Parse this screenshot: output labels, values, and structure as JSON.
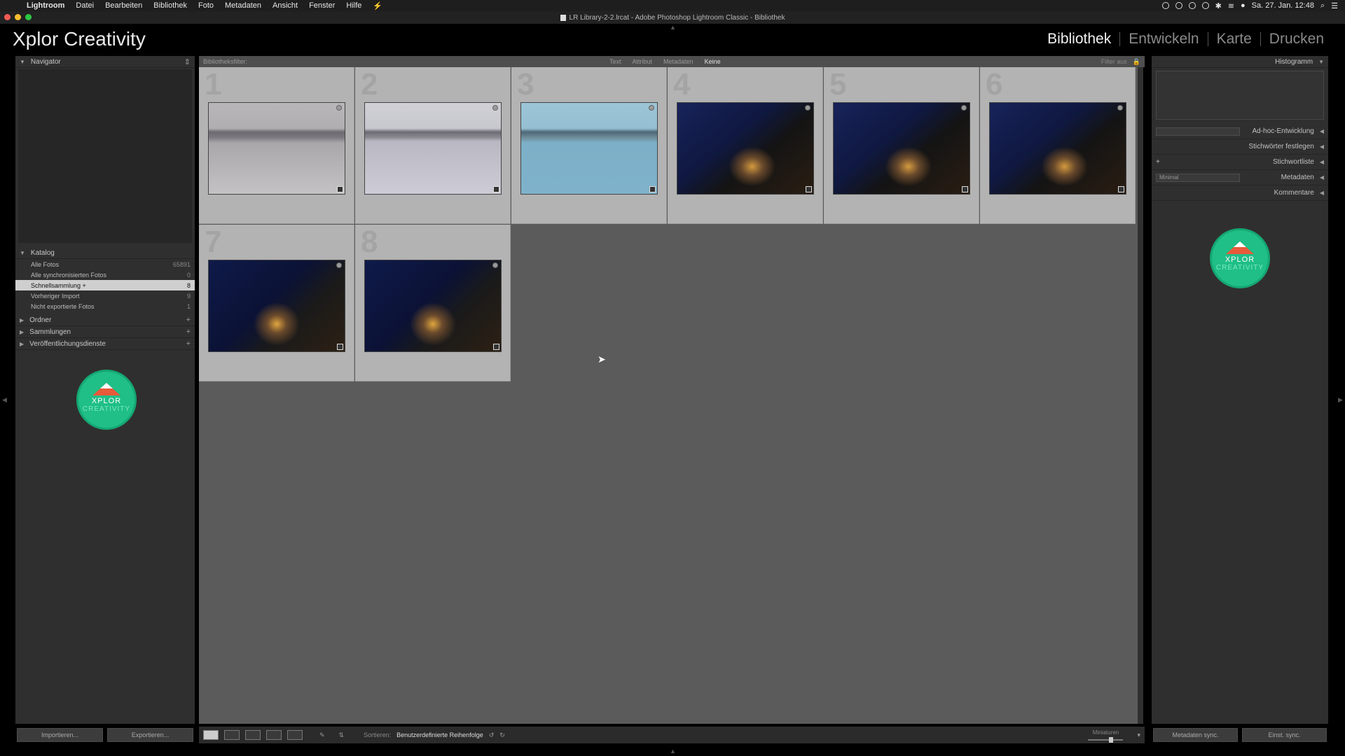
{
  "menubar": {
    "app_name": "Lightroom",
    "items": [
      "Datei",
      "Bearbeiten",
      "Bibliothek",
      "Foto",
      "Metadaten",
      "Ansicht",
      "Fenster",
      "Hilfe"
    ],
    "clock": "Sa. 27. Jan. 12:48"
  },
  "window": {
    "title": "LR Library-2-2.lrcat - Adobe Photoshop Lightroom Classic - Bibliothek"
  },
  "identity_plate": "Xplor Creativity",
  "modules": [
    {
      "label": "Bibliothek",
      "active": true
    },
    {
      "label": "Entwickeln",
      "active": false
    },
    {
      "label": "Karte",
      "active": false
    },
    {
      "label": "Drucken",
      "active": false
    }
  ],
  "left_panel": {
    "navigator_title": "Navigator",
    "catalog_title": "Katalog",
    "catalog_items": [
      {
        "label": "Alle Fotos",
        "count": "65891"
      },
      {
        "label": "Alle synchronisierten Fotos",
        "count": "0"
      },
      {
        "label": "Schnellsammlung +",
        "count": "8"
      },
      {
        "label": "Vorheriger Import",
        "count": "9"
      },
      {
        "label": "Nicht exportierte Fotos",
        "count": "1"
      }
    ],
    "folders_title": "Ordner",
    "collections_title": "Sammlungen",
    "publish_title": "Veröffentlichungsdienste",
    "import_button": "Importieren...",
    "export_button": "Exportieren..."
  },
  "badge": {
    "line1": "XPLOR",
    "line2": "CREATIVITY"
  },
  "filter_bar": {
    "label": "Bibliotheksfilter:",
    "tabs": [
      {
        "label": "Text",
        "active": false
      },
      {
        "label": "Attribut",
        "active": false
      },
      {
        "label": "Metadaten",
        "active": false
      },
      {
        "label": "Keine",
        "active": true
      }
    ],
    "filter_state": "Filter aus"
  },
  "grid": {
    "cells": [
      {
        "number": "1",
        "style": "img-fog"
      },
      {
        "number": "2",
        "style": "img-grey"
      },
      {
        "number": "3",
        "style": "img-blue"
      },
      {
        "number": "4",
        "style": "img-night"
      },
      {
        "number": "5",
        "style": "img-night"
      },
      {
        "number": "6",
        "style": "img-night"
      },
      {
        "number": "7",
        "style": "img-night2"
      },
      {
        "number": "8",
        "style": "img-night2"
      }
    ]
  },
  "toolbar": {
    "sort_label": "Sortieren:",
    "sort_value": "Benutzerdefinierte Reihenfolge",
    "thumbnails_label": "Miniaturen",
    "thumbnail_size": 0.6
  },
  "right_panel": {
    "histogram_title": "Histogramm",
    "rows": [
      "Ad-hoc-Entwicklung",
      "Stichwörter festlegen",
      "Stichwortliste",
      "Metadaten",
      "Kommentare"
    ],
    "metadata_preset": "Minimal",
    "sync_metadata_button": "Metadaten sync.",
    "sync_settings_button": "Einst. sync."
  }
}
